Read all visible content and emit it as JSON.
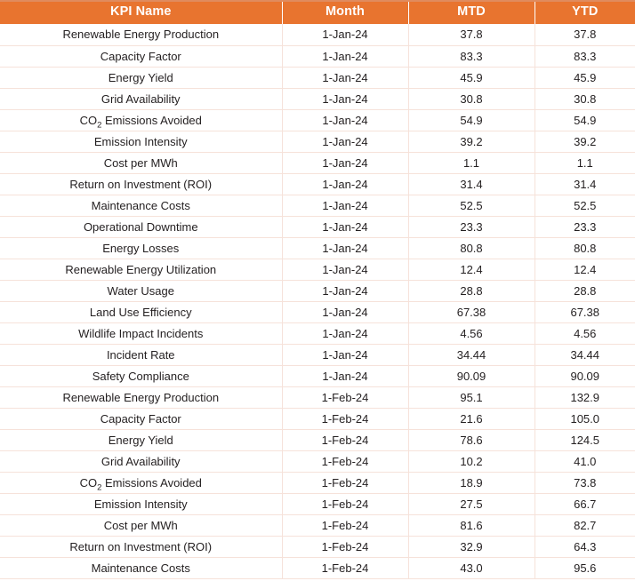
{
  "table": {
    "columns": [
      {
        "key": "kpi",
        "label": "KPI Name"
      },
      {
        "key": "month",
        "label": "Month"
      },
      {
        "key": "mtd",
        "label": "MTD"
      },
      {
        "key": "ytd",
        "label": "YTD"
      }
    ],
    "header_background": "#E8742F",
    "header_text_color": "#FFFFFF",
    "row_separator_color": "#F6E2DA",
    "body_text_color": "#231F20",
    "rows": [
      {
        "kpi": "Renewable Energy Production",
        "month": "1-Jan-24",
        "mtd": "37.8",
        "ytd": "37.8"
      },
      {
        "kpi": "Capacity Factor",
        "month": "1-Jan-24",
        "mtd": "83.3",
        "ytd": "83.3"
      },
      {
        "kpi": "Energy Yield",
        "month": "1-Jan-24",
        "mtd": "45.9",
        "ytd": "45.9"
      },
      {
        "kpi": "Grid Availability",
        "month": "1-Jan-24",
        "mtd": "30.8",
        "ytd": "30.8"
      },
      {
        "kpi": "CO@2@ Emissions Avoided",
        "month": "1-Jan-24",
        "mtd": "54.9",
        "ytd": "54.9"
      },
      {
        "kpi": "Emission Intensity",
        "month": "1-Jan-24",
        "mtd": "39.2",
        "ytd": "39.2"
      },
      {
        "kpi": "Cost per MWh",
        "month": "1-Jan-24",
        "mtd": "1.1",
        "ytd": "1.1"
      },
      {
        "kpi": "Return on Investment (ROI)",
        "month": "1-Jan-24",
        "mtd": "31.4",
        "ytd": "31.4"
      },
      {
        "kpi": "Maintenance Costs",
        "month": "1-Jan-24",
        "mtd": "52.5",
        "ytd": "52.5"
      },
      {
        "kpi": "Operational Downtime",
        "month": "1-Jan-24",
        "mtd": "23.3",
        "ytd": "23.3"
      },
      {
        "kpi": "Energy Losses",
        "month": "1-Jan-24",
        "mtd": "80.8",
        "ytd": "80.8"
      },
      {
        "kpi": "Renewable Energy Utilization",
        "month": "1-Jan-24",
        "mtd": "12.4",
        "ytd": "12.4"
      },
      {
        "kpi": "Water Usage",
        "month": "1-Jan-24",
        "mtd": "28.8",
        "ytd": "28.8"
      },
      {
        "kpi": "Land Use Efficiency",
        "month": "1-Jan-24",
        "mtd": "67.38",
        "ytd": "67.38"
      },
      {
        "kpi": "Wildlife Impact Incidents",
        "month": "1-Jan-24",
        "mtd": "4.56",
        "ytd": "4.56"
      },
      {
        "kpi": "Incident Rate",
        "month": "1-Jan-24",
        "mtd": "34.44",
        "ytd": "34.44"
      },
      {
        "kpi": "Safety Compliance",
        "month": "1-Jan-24",
        "mtd": "90.09",
        "ytd": "90.09"
      },
      {
        "kpi": "Renewable Energy Production",
        "month": "1-Feb-24",
        "mtd": "95.1",
        "ytd": "132.9"
      },
      {
        "kpi": "Capacity Factor",
        "month": "1-Feb-24",
        "mtd": "21.6",
        "ytd": "105.0"
      },
      {
        "kpi": "Energy Yield",
        "month": "1-Feb-24",
        "mtd": "78.6",
        "ytd": "124.5"
      },
      {
        "kpi": "Grid Availability",
        "month": "1-Feb-24",
        "mtd": "10.2",
        "ytd": "41.0"
      },
      {
        "kpi": "CO@2@ Emissions Avoided",
        "month": "1-Feb-24",
        "mtd": "18.9",
        "ytd": "73.8"
      },
      {
        "kpi": "Emission Intensity",
        "month": "1-Feb-24",
        "mtd": "27.5",
        "ytd": "66.7"
      },
      {
        "kpi": "Cost per MWh",
        "month": "1-Feb-24",
        "mtd": "81.6",
        "ytd": "82.7"
      },
      {
        "kpi": "Return on Investment (ROI)",
        "month": "1-Feb-24",
        "mtd": "32.9",
        "ytd": "64.3"
      },
      {
        "kpi": "Maintenance Costs",
        "month": "1-Feb-24",
        "mtd": "43.0",
        "ytd": "95.6"
      }
    ]
  }
}
